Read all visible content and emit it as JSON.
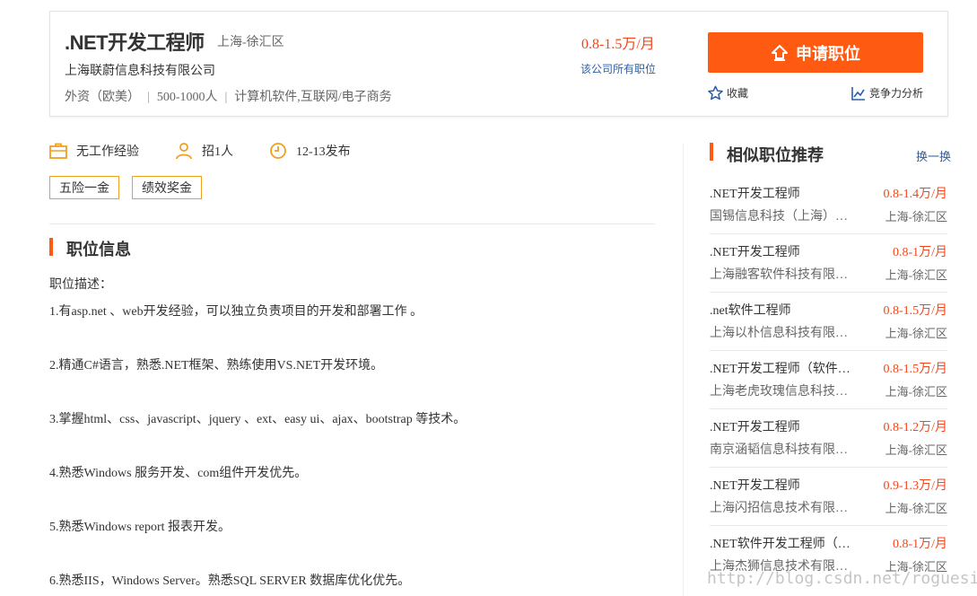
{
  "header": {
    "title": ".NET开发工程师",
    "location": "上海-徐汇区",
    "company": "上海联蔚信息科技有限公司",
    "meta": [
      "外资（欧美）",
      "500-1000人",
      "计算机软件,互联网/电子商务"
    ],
    "salary": "0.8-1.5万/月",
    "all_jobs_link": "该公司所有职位",
    "apply_label": "申请职位",
    "favorite_label": "收藏",
    "compete_label": "竞争力分析"
  },
  "attributes": {
    "experience": "无工作经验",
    "headcount": "招1人",
    "published": "12-13发布"
  },
  "tags": [
    "五险一金",
    "绩效奖金"
  ],
  "job_info": {
    "section_title": "职位信息",
    "desc_label": "职位描述：",
    "lines": [
      "1.有asp.net 、web开发经验，可以独立负责项目的开发和部署工作 。",
      "2.精通C#语言，熟悉.NET框架、熟练使用VS.NET开发环境。",
      "3.掌握html、css、javascript、jquery 、ext、easy ui、ajax、bootstrap 等技术。",
      "4.熟悉Windows 服务开发、com组件开发优先。",
      "5.熟悉Windows report 报表开发。",
      "6.熟悉IIS，Windows Server。熟悉SQL SERVER 数据库优化优先。"
    ]
  },
  "sidebar": {
    "title": "相似职位推荐",
    "refresh_label": "换一换",
    "items": [
      {
        "title": ".NET开发工程师",
        "salary": "0.8-1.4万/月",
        "company": "国锡信息科技（上海）有限公司",
        "location": "上海-徐汇区"
      },
      {
        "title": ".NET开发工程师",
        "salary": "0.8-1万/月",
        "company": "上海融客软件科技有限公司",
        "location": "上海-徐汇区"
      },
      {
        "title": ".net软件工程师",
        "salary": "0.8-1.5万/月",
        "company": "上海以朴信息科技有限公司",
        "location": "上海-徐汇区"
      },
      {
        "title": ".NET开发工程师（软件开发）",
        "salary": "0.8-1.5万/月",
        "company": "上海老虎玫瑰信息科技有限公司",
        "location": "上海-徐汇区"
      },
      {
        "title": ".NET开发工程师",
        "salary": "0.8-1.2万/月",
        "company": "南京涵韬信息科技有限公司",
        "location": "上海-徐汇区"
      },
      {
        "title": ".NET开发工程师",
        "salary": "0.9-1.3万/月",
        "company": "上海闪招信息技术有限公司",
        "location": "上海-徐汇区"
      },
      {
        "title": ".NET软件开发工程师（C#）",
        "salary": "0.8-1万/月",
        "company": "上海杰狮信息技术有限公司",
        "location": "上海-徐汇区"
      }
    ]
  },
  "watermark": "http://blog.csdn.net/roguesir",
  "colors": {
    "accent": "#fe5a12",
    "salary": "#f3471b",
    "link": "#2a5fa8",
    "tag_border": "#f0a020"
  }
}
